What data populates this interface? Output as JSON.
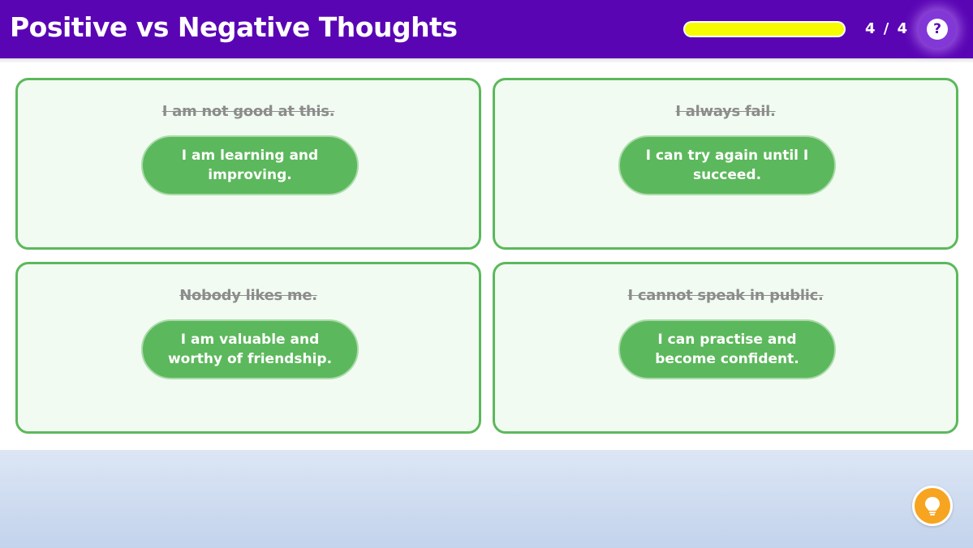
{
  "header": {
    "title": "Positive vs Negative Thoughts",
    "progress": 1.0,
    "counter": "4 / 4",
    "help_icon": "question-icon",
    "help_glyph": "?"
  },
  "cards": [
    {
      "negative": "I am not good at this.",
      "positive": "I am learning and improving."
    },
    {
      "negative": "I always fail.",
      "positive": "I can try again until I succeed."
    },
    {
      "negative": "Nobody likes me.",
      "positive": "I am valuable and worthy of friendship."
    },
    {
      "negative": "I cannot speak in public.",
      "positive": "I can practise and become confident."
    }
  ],
  "footer": {
    "hint_icon": "lightbulb-icon"
  },
  "colors": {
    "header_bg": "#5a05b4",
    "progress_fill": "#f7fb00",
    "card_border": "#5cb85c",
    "card_bg": "#f1fbf1",
    "hint_button": "#f7a420"
  }
}
